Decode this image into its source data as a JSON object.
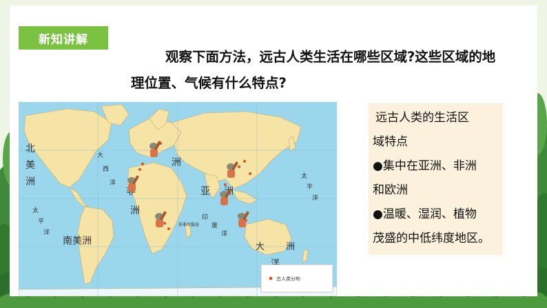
{
  "slide": {
    "section_badge": "新知讲解",
    "question_line1": "观察下面方法，远古人类生活在哪些区域?这些区域的地",
    "question_line2": "理位置、气候有什么特点?"
  },
  "info_box": {
    "lines": [
      "远古人类的生活区",
      "域特点",
      "●集中在亚洲、非洲",
      "和欧洲",
      "●温暖、湿润、植物",
      "茂盛的中低纬度地区。"
    ]
  },
  "map": {
    "labels": {
      "north_america_1": "北",
      "north_america_2": "美",
      "north_america_3": "洲",
      "south_america": "南美洲",
      "europe": "洲",
      "asia": "亚",
      "asia_2": "洲",
      "africa": "非",
      "africa_2": "洲",
      "oceania_1": "大",
      "oceania_2": "洋",
      "oceania_3": "洲",
      "ocean_1": "大",
      "ocean_2": "西",
      "ocean_3": "洋",
      "ocean_4": "印",
      "ocean_5": "度",
      "ocean_6": "洋",
      "ocean_7": "太",
      "ocean_8": "平",
      "ocean_9": "洋",
      "ocean_10": "太",
      "ocean_11": "平",
      "ocean_12": "洋",
      "site_label": "东非大裂谷"
    },
    "legend": {
      "label": "古人类分布"
    }
  },
  "colors": {
    "badge": "#7cc242",
    "ocean": "#9ad7ec",
    "land": "#f6e3a6",
    "info_bg": "#fbf1dc",
    "site_dot": "#e2541c",
    "caveman_skin": "#d7744a"
  }
}
